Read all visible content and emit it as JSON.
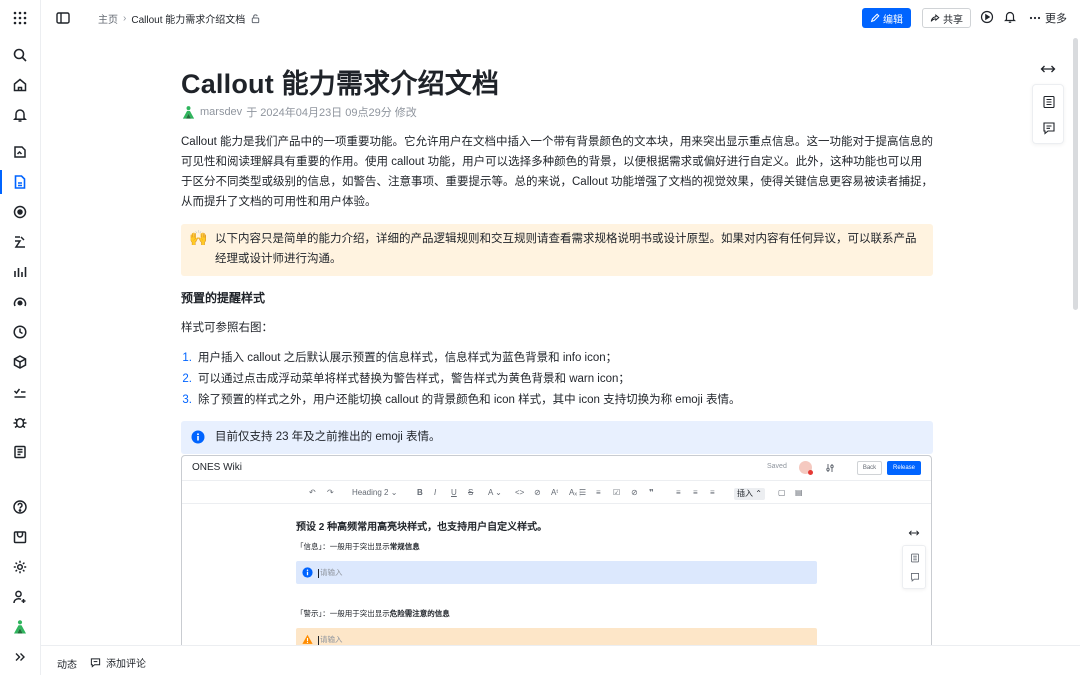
{
  "breadcrumb": {
    "home": "主页",
    "separator": "›",
    "current": "Callout 能力需求介绍文档"
  },
  "toolbar": {
    "edit_label": "编辑",
    "share_label": "共享",
    "more_label": "更多"
  },
  "document": {
    "title": "Callout 能力需求介绍文档",
    "meta": {
      "author": "marsdev",
      "text": "于 2024年04月23日 09点29分 修改"
    },
    "intro": "Callout 能力是我们产品中的一项重要功能。它允许用户在文档中插入一个带有背景颜色的文本块，用来突出显示重点信息。这一功能对于提高信息的可见性和阅读理解具有重要的作用。使用 callout 功能，用户可以选择多种颜色的背景，以便根据需求或偏好进行自定义。此外，这种功能也可以用于区分不同类型或级别的信息，如警告、注意事项、重要提示等。总的来说，Callout 功能增强了文档的视觉效果，使得关键信息更容易被读者捕捉，从而提升了文档的可用性和用户体验。",
    "warn_callout": {
      "emoji": "🙌",
      "text": "以下内容只是简单的能力介绍，详细的产品逻辑规则和交互规则请查看需求规格说明书或设计原型。如果对内容有任何异议，可以联系产品经理或设计师进行沟通。"
    },
    "section_heading": "预置的提醒样式",
    "section_intro": "样式可参照右图：",
    "list": [
      {
        "num": "1.",
        "text": "用户插入 callout 之后默认展示预置的信息样式，信息样式为蓝色背景和 info icon；"
      },
      {
        "num": "2.",
        "text": "可以通过点击成浮动菜单将样式替换为警告样式，警告样式为黄色背景和 warn icon；"
      },
      {
        "num": "3.",
        "text": "除了预置的样式之外，用户还能切换 callout 的背景颜色和 icon 样式，其中 icon 支持切换为称 emoji 表情。"
      }
    ],
    "info_callout": "目前仅支持 23 年及之前推出的 emoji 表情。"
  },
  "embedded": {
    "app_title": "ONES Wiki",
    "saved": "Saved",
    "back": "Back",
    "release": "Release",
    "toolbar": {
      "heading": "Heading 2",
      "insert": "插入"
    },
    "heading": "预设 2 种高频常用高亮块样式，也支持用户自定义样式。",
    "info_label_prefix": "「信息」：一般用于突出显示",
    "info_label_bold": "常规信息",
    "info_placeholder": "请输入",
    "warn_label_prefix": "「警示」：一般用于突出显示",
    "warn_label_bold": "危险需注意的信息",
    "warn_placeholder": "请输入"
  },
  "bottom": {
    "activity": "动态",
    "comment": "添加评论"
  },
  "colors": {
    "accent": "#0064ff",
    "warn_bg": "#fff3e0",
    "info_bg": "#e8f0fe",
    "brand_green": "#2fb55d"
  }
}
